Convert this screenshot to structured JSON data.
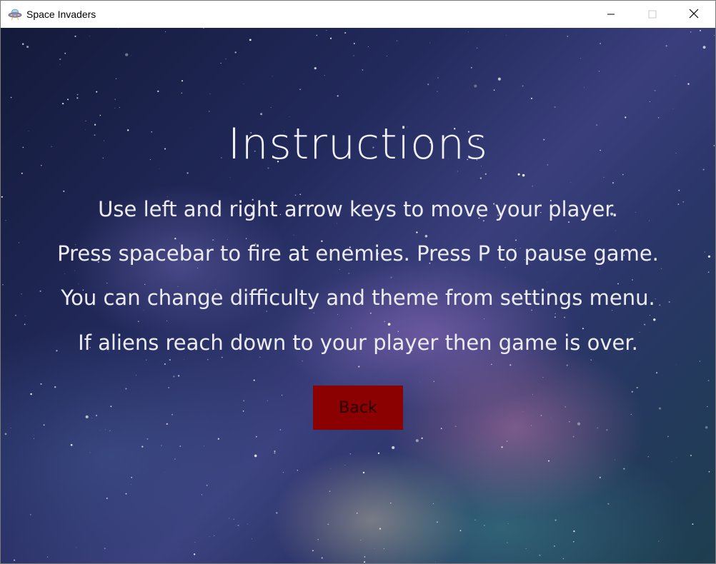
{
  "window": {
    "title": "Space Invaders",
    "app_icon": "ufo-icon",
    "controls": {
      "minimize_icon": "minimize-icon",
      "maximize_icon": "maximize-icon",
      "close_icon": "close-icon"
    }
  },
  "screen": {
    "heading": "Instructions",
    "lines": [
      "Use left and right arrow keys to move your player.",
      "Press spacebar to fire at enemies. Press P to pause game.",
      "You can change difficulty and theme from settings menu.",
      "If aliens reach down to your player then game is over."
    ],
    "back_label": "Back"
  },
  "colors": {
    "back_button": "#8b0000",
    "text": "#ececf0"
  }
}
